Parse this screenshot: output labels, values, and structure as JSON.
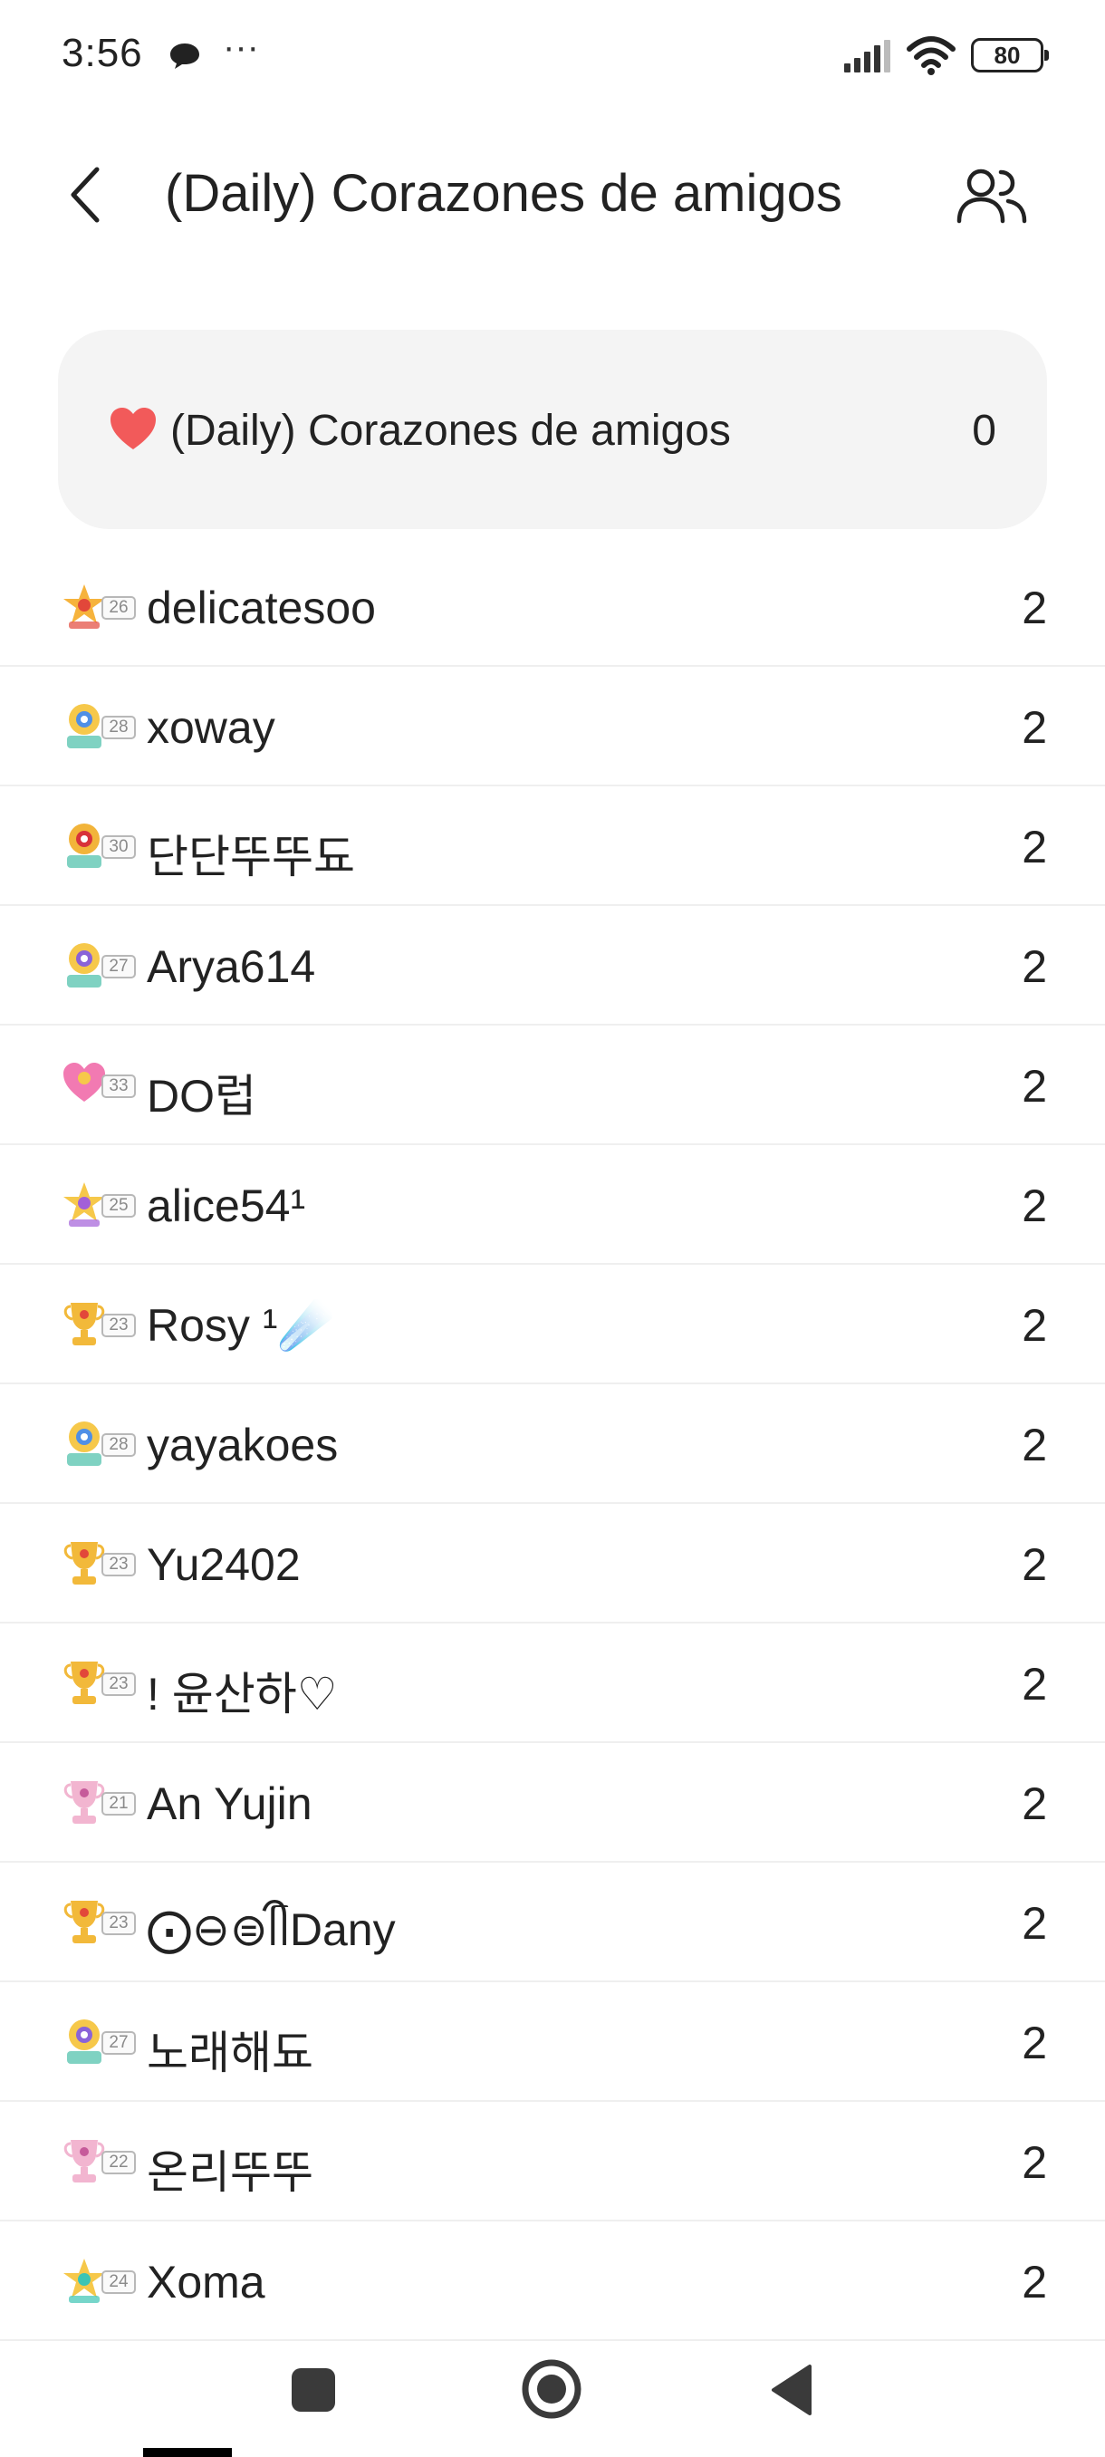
{
  "status_bar": {
    "time": "3:56",
    "dots": "···",
    "battery": "80"
  },
  "header": {
    "title": "(Daily) Corazones de amigos"
  },
  "summary": {
    "label": "(Daily) Corazones de amigos",
    "count": "0"
  },
  "colors": {
    "heart": "#f25a5a",
    "card_bg": "#f4f4f4"
  },
  "friends": [
    {
      "level": "26",
      "name": "delicatesoo",
      "value": "2",
      "medal": "star-red"
    },
    {
      "level": "28",
      "name": "xoway",
      "value": "2",
      "medal": "flower-blue"
    },
    {
      "level": "30",
      "name": "단단뚜뚜됴",
      "value": "2",
      "medal": "gem-red"
    },
    {
      "level": "27",
      "name": "Arya614",
      "value": "2",
      "medal": "flower-purple"
    },
    {
      "level": "33",
      "name": "DO럽",
      "value": "2",
      "medal": "heart-pink"
    },
    {
      "level": "25",
      "name": "alice54¹",
      "value": "2",
      "medal": "star-purple"
    },
    {
      "level": "23",
      "name": "Rosy ¹☄️",
      "value": "2",
      "medal": "trophy-gold"
    },
    {
      "level": "28",
      "name": "yayakoes",
      "value": "2",
      "medal": "flower-blue"
    },
    {
      "level": "23",
      "name": "Yu2402",
      "value": "2",
      "medal": "trophy-gold"
    },
    {
      "level": "23",
      "name": "! 윤산하♡",
      "value": "2",
      "medal": "trophy-gold"
    },
    {
      "level": "21",
      "name": "An Yujin",
      "value": "2",
      "medal": "trophy-pink"
    },
    {
      "level": "23",
      "name": "⨀⊖⊜ᥬᩤDany",
      "value": "2",
      "medal": "trophy-gold"
    },
    {
      "level": "27",
      "name": "노래해됴",
      "value": "2",
      "medal": "flower-purple"
    },
    {
      "level": "22",
      "name": "온리뚜뚜",
      "value": "2",
      "medal": "trophy-pink"
    },
    {
      "level": "24",
      "name": "Xoma",
      "value": "2",
      "medal": "star-teal"
    }
  ]
}
